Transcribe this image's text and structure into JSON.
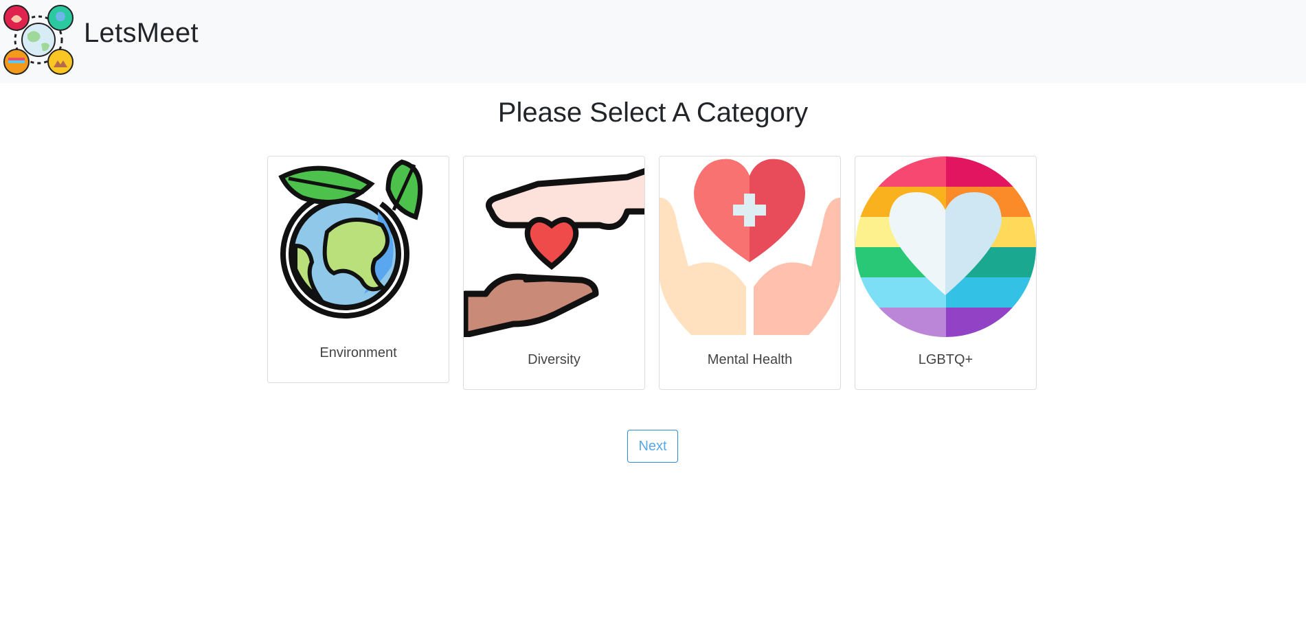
{
  "header": {
    "brand": "LetsMeet",
    "logo_icon": "globe-community-icon"
  },
  "main": {
    "title": "Please Select A Category",
    "categories": [
      {
        "label": "Environment",
        "icon": "earth-leaves-icon"
      },
      {
        "label": "Diversity",
        "icon": "hands-heart-icon"
      },
      {
        "label": "Mental Health",
        "icon": "heart-cross-hands-icon"
      },
      {
        "label": "LGBTQ+",
        "icon": "rainbow-heart-icon"
      }
    ],
    "next_label": "Next"
  },
  "colors": {
    "navbar_bg": "#f8f9fa",
    "button_accent": "#2d8cd8"
  }
}
